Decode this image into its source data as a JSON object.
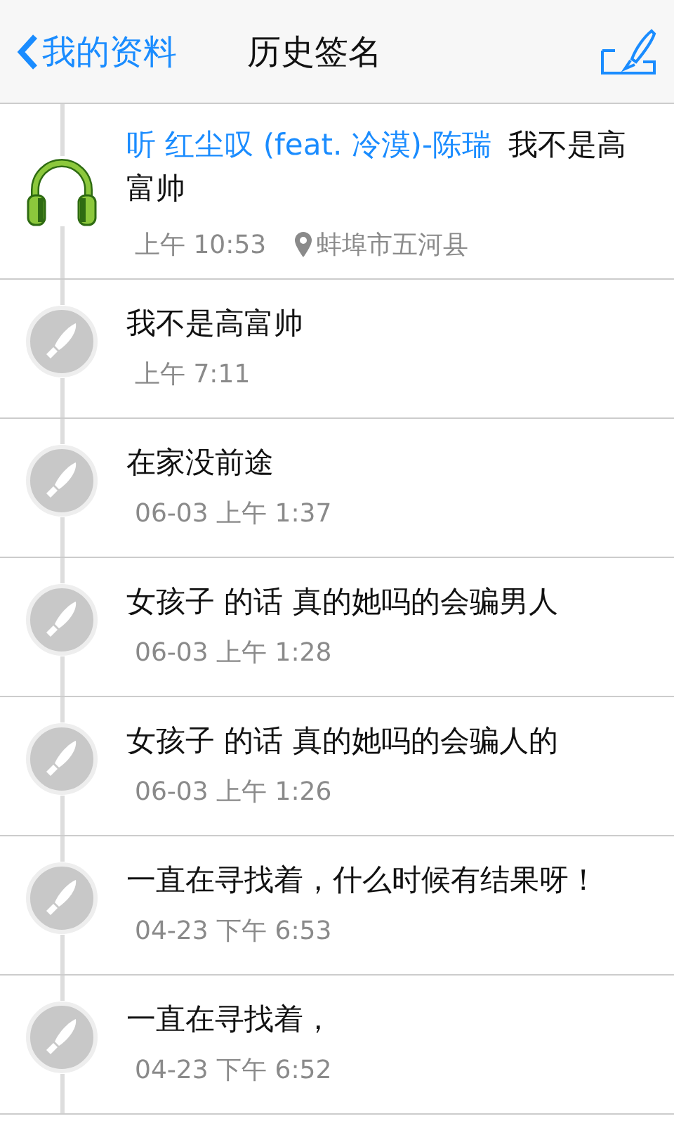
{
  "header": {
    "back_label": "我的资料",
    "title": "历史签名"
  },
  "signatures": [
    {
      "kind": "music",
      "song": "听 红尘叹 (feat. 冷漠)-陈瑞",
      "text": "我不是高富帅",
      "time": "上午 10:53",
      "location": "蚌埠市五河县"
    },
    {
      "kind": "text",
      "text": "我不是高富帅",
      "time": "上午 7:11"
    },
    {
      "kind": "text",
      "text": "在家没前途",
      "time": "06-03 上午 1:37"
    },
    {
      "kind": "text",
      "text": "女孩子 的话 真的她吗的会骗男人",
      "time": "06-03 上午 1:28"
    },
    {
      "kind": "text",
      "text": "女孩子 的话 真的她吗的会骗人的",
      "time": "06-03 上午 1:26"
    },
    {
      "kind": "text",
      "text": "一直在寻找着，什么时候有结果呀！",
      "time": "04-23 下午 6:53"
    },
    {
      "kind": "text",
      "text": "一直在寻找着，",
      "time": "04-23 下午 6:52"
    }
  ]
}
